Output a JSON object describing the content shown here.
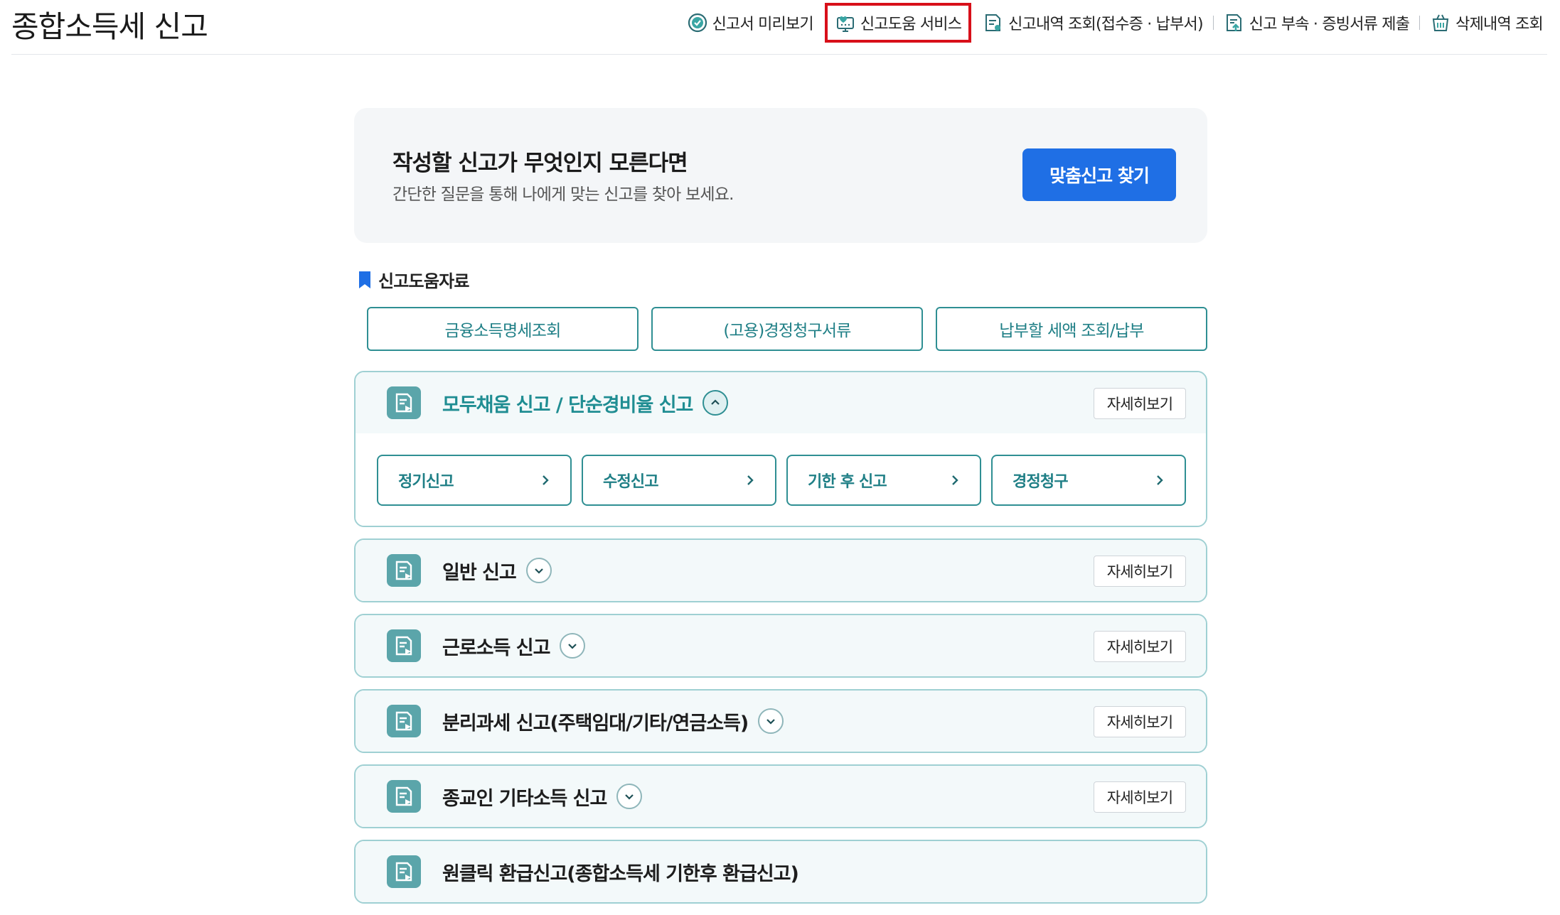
{
  "header": {
    "title": "종합소득세 신고",
    "nav": [
      {
        "label": "신고서 미리보기",
        "icon": "check-circle-icon"
      },
      {
        "label": "신고도움 서비스",
        "icon": "help-monitor-icon",
        "highlighted": true
      },
      {
        "label": "신고내역 조회(접수증 · 납부서)",
        "icon": "document-search-icon"
      },
      {
        "label": "신고 부속 · 증빙서류 제출",
        "icon": "document-upload-icon"
      },
      {
        "label": "삭제내역 조회",
        "icon": "trash-basket-icon"
      }
    ]
  },
  "banner": {
    "title": "작성할 신고가 무엇인지 모른다면",
    "description": "간단한 질문을 통해 나에게 맞는 신고를 찾아 보세요.",
    "button": "맞춤신고 찾기"
  },
  "help_section": {
    "heading": "신고도움자료",
    "links": [
      "금융소득명세조회",
      "(고용)경정청구서류",
      "납부할 세액 조회/납부"
    ]
  },
  "accordion": [
    {
      "title": "모두채움 신고 / 단순경비율 신고",
      "detail": "자세히보기",
      "open": true,
      "options": [
        "정기신고",
        "수정신고",
        "기한 후 신고",
        "경정청구"
      ]
    },
    {
      "title": "일반 신고",
      "detail": "자세히보기",
      "open": false
    },
    {
      "title": "근로소득 신고",
      "detail": "자세히보기",
      "open": false
    },
    {
      "title": "분리과세 신고(주택임대/기타/연금소득)",
      "detail": "자세히보기",
      "open": false
    },
    {
      "title": "종교인 기타소득 신고",
      "detail": "자세히보기",
      "open": false
    },
    {
      "title": "원클릭 환급신고(종합소득세 기한후 환급신고)",
      "detail": "",
      "open": false
    }
  ],
  "colors": {
    "primary_blue": "#1f6fe5",
    "teal": "#2f8f93",
    "highlight_red": "#d8101a"
  }
}
